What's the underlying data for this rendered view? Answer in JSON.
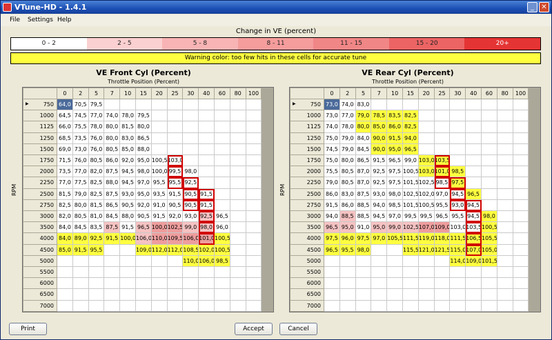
{
  "window": {
    "title": "VTune-HD - 1.4.1"
  },
  "menu": [
    "File",
    "Settings",
    "Help"
  ],
  "change_ve": {
    "title": "Change in VE (percent)",
    "ranges": [
      {
        "label": "0 - 2",
        "color": "#ffffff"
      },
      {
        "label": "2 - 5",
        "color": "#fbd0d0"
      },
      {
        "label": "5 - 8",
        "color": "#f8b4b4"
      },
      {
        "label": "8 - 11",
        "color": "#f59c9c"
      },
      {
        "label": "11 - 15",
        "color": "#f18686"
      },
      {
        "label": "15 - 20",
        "color": "#ec6464"
      },
      {
        "label": "20+",
        "color": "#e53434"
      }
    ]
  },
  "warning": {
    "text": "Warning color: too few hits in these cells for accurate tune",
    "color": "#ffff40"
  },
  "colors": {
    "cell_warn": "#ffff40",
    "cell_light_red": "#f6c2c2",
    "cell_red": "#ee9d9d",
    "highlight": "#d00000"
  },
  "axes": {
    "throttle": [
      "0",
      "2",
      "5",
      "7",
      "10",
      "15",
      "20",
      "25",
      "30",
      "40",
      "60",
      "80",
      "100"
    ],
    "rpm": [
      "750",
      "1000",
      "1125",
      "1250",
      "1500",
      "1750",
      "2000",
      "2250",
      "2500",
      "2750",
      "3000",
      "3500",
      "4000",
      "4500",
      "5000",
      "5500",
      "6000",
      "6500",
      "7000"
    ]
  },
  "tables": [
    {
      "title": "VE Front Cyl (Percent)",
      "xlabel": "Throttle Position (Percent)",
      "ylabel": "RPM",
      "rows": [
        [
          "64,0",
          "70,5",
          "79,5",
          "",
          "",
          "",
          "",
          "",
          "",
          "",
          "",
          "",
          ""
        ],
        [
          "64,5",
          "74,5",
          "77,0",
          "74,0",
          "78,0",
          "79,5",
          "",
          "",
          "",
          "",
          "",
          "",
          ""
        ],
        [
          "66,0",
          "75,5",
          "78,0",
          "80,0",
          "81,5",
          "80,0",
          "",
          "",
          "",
          "",
          "",
          "",
          ""
        ],
        [
          "68,5",
          "73,5",
          "76,0",
          "80,0",
          "83,0",
          "86,5",
          "",
          "",
          "",
          "",
          "",
          "",
          ""
        ],
        [
          "69,0",
          "73,0",
          "76,0",
          "80,5",
          "85,0",
          "88,0",
          "",
          "",
          "",
          "",
          "",
          "",
          ""
        ],
        [
          "71,5",
          "76,0",
          "80,5",
          "86,0",
          "92,0",
          "95,0",
          "100,5",
          "103,0",
          "",
          "",
          "",
          "",
          ""
        ],
        [
          "73,5",
          "77,0",
          "82,0",
          "87,5",
          "94,5",
          "98,0",
          "100,0",
          "99,5",
          "98,0",
          "",
          "",
          "",
          ""
        ],
        [
          "77,0",
          "77,5",
          "82,5",
          "88,0",
          "94,5",
          "97,0",
          "95,5",
          "95,5",
          "92,5",
          "",
          "",
          "",
          ""
        ],
        [
          "81,5",
          "79,0",
          "82,5",
          "87,5",
          "93,0",
          "95,0",
          "93,5",
          "91,5",
          "90,5",
          "91,5",
          "",
          "",
          ""
        ],
        [
          "82,5",
          "80,0",
          "81,5",
          "86,5",
          "90,5",
          "92,0",
          "91,0",
          "90,5",
          "90,5",
          "91,5",
          "",
          "",
          ""
        ],
        [
          "82,0",
          "80,5",
          "81,0",
          "84,5",
          "88,0",
          "90,5",
          "91,5",
          "92,0",
          "93,0",
          "92,5",
          "96,5",
          "",
          ""
        ],
        [
          "84,0",
          "84,5",
          "83,5",
          "87,5",
          "91,5",
          "96,5",
          "100,0",
          "102,5",
          "99,0",
          "98,0",
          "96,0",
          "",
          ""
        ],
        [
          "84,0",
          "89,0",
          "92,5",
          "91,5",
          "100,0",
          "106,0",
          "110,0",
          "109,5",
          "106,0",
          "101,0",
          "100,5",
          "",
          ""
        ],
        [
          "85,0",
          "91,5",
          "95,5",
          "",
          "",
          "109,0",
          "112,0",
          "112,0",
          "108,5",
          "102,0",
          "100,5",
          "",
          ""
        ],
        [
          "",
          "",
          "",
          "",
          "",
          "",
          "",
          "",
          "110,0",
          "106,0",
          "98,5",
          "",
          ""
        ],
        [
          "",
          "",
          "",
          "",
          "",
          "",
          "",
          "",
          "",
          "",
          "",
          "",
          ""
        ],
        [
          "",
          "",
          "",
          "",
          "",
          "",
          "",
          "",
          "",
          "",
          "",
          "",
          ""
        ],
        [
          "",
          "",
          "",
          "",
          "",
          "",
          "",
          "",
          "",
          "",
          "",
          "",
          ""
        ],
        [
          "",
          "",
          "",
          "",
          "",
          "",
          "",
          "",
          "",
          "",
          "",
          "",
          ""
        ]
      ],
      "colors": [
        "SWWW.........",
        "WWWWWW.......",
        "WWWWWW.......",
        "WWWWWW.......",
        "WWWWWW.......",
        "WWWWWWWW.....",
        "WWWWWWWWW....",
        "WWWWWWWWW....",
        "WWWWWWWWWW...",
        "WWWWWWWWWW...",
        "WWWWWWWWWLW..",
        "WWWLWLRRLLW..",
        "YYYYYLRRRRY..",
        "YYY..YYYYYY..",
        "........YYY..",
        ".............",
        ".............",
        ".............",
        "............."
      ],
      "highlighted": [
        [
          5,
          7
        ],
        [
          6,
          7
        ],
        [
          7,
          7
        ],
        [
          7,
          8
        ],
        [
          8,
          8
        ],
        [
          9,
          8
        ],
        [
          8,
          9
        ],
        [
          9,
          9
        ],
        [
          10,
          9
        ],
        [
          11,
          9
        ],
        [
          12,
          9
        ]
      ]
    },
    {
      "title": "VE Rear Cyl (Percent)",
      "xlabel": "Throttle Position (Percent)",
      "ylabel": "RPM",
      "rows": [
        [
          "73,0",
          "74,0",
          "83,0",
          "",
          "",
          "",
          "",
          "",
          "",
          "",
          "",
          "",
          ""
        ],
        [
          "73,0",
          "77,0",
          "79,0",
          "78,5",
          "83,5",
          "82,5",
          "",
          "",
          "",
          "",
          "",
          "",
          ""
        ],
        [
          "74,0",
          "78,0",
          "80,0",
          "85,0",
          "86,0",
          "82,5",
          "",
          "",
          "",
          "",
          "",
          "",
          ""
        ],
        [
          "75,0",
          "79,0",
          "84,0",
          "90,0",
          "91,5",
          "94,0",
          "",
          "",
          "",
          "",
          "",
          "",
          ""
        ],
        [
          "74,5",
          "79,0",
          "84,5",
          "90,0",
          "95,0",
          "96,5",
          "",
          "",
          "",
          "",
          "",
          "",
          ""
        ],
        [
          "75,0",
          "80,0",
          "86,5",
          "91,5",
          "96,5",
          "99,0",
          "103,0",
          "103,5",
          "",
          "",
          "",
          "",
          ""
        ],
        [
          "75,5",
          "80,5",
          "87,0",
          "92,5",
          "97,5",
          "100,5",
          "103,0",
          "101,0",
          "98,5",
          "",
          "",
          "",
          ""
        ],
        [
          "79,0",
          "80,5",
          "87,0",
          "92,5",
          "97,5",
          "101,5",
          "102,5",
          "98,5",
          "97,5",
          "",
          "",
          "",
          ""
        ],
        [
          "86,0",
          "83,0",
          "87,5",
          "93,0",
          "98,0",
          "102,5",
          "102,0",
          "97,0",
          "94,5",
          "96,5",
          "",
          "",
          ""
        ],
        [
          "91,5",
          "86,0",
          "88,5",
          "94,0",
          "98,5",
          "101,5",
          "100,5",
          "95,5",
          "93,0",
          "94,5",
          "",
          "",
          ""
        ],
        [
          "94,0",
          "88,5",
          "88,5",
          "94,5",
          "97,0",
          "99,5",
          "99,5",
          "96,5",
          "95,5",
          "94,5",
          "98,0",
          "",
          ""
        ],
        [
          "96,5",
          "95,0",
          "91,0",
          "95,0",
          "99,0",
          "102,5",
          "107,0",
          "109,0",
          "103,0",
          "103,5",
          "100,5",
          "",
          ""
        ],
        [
          "97,5",
          "96,0",
          "97,5",
          "97,0",
          "105,5",
          "111,5",
          "119,0",
          "118,0",
          "111,5",
          "106,5",
          "105,5",
          "",
          ""
        ],
        [
          "96,5",
          "95,5",
          "98,0",
          "",
          "",
          "115,5",
          "121,0",
          "121,5",
          "115,0",
          "107,0",
          "105,0",
          "",
          ""
        ],
        [
          "",
          "",
          "",
          "",
          "",
          "",
          "",
          "",
          "114,0",
          "109,0",
          "101,5",
          "",
          ""
        ],
        [
          "",
          "",
          "",
          "",
          "",
          "",
          "",
          "",
          "",
          "",
          "",
          "",
          ""
        ],
        [
          "",
          "",
          "",
          "",
          "",
          "",
          "",
          "",
          "",
          "",
          "",
          "",
          ""
        ],
        [
          "",
          "",
          "",
          "",
          "",
          "",
          "",
          "",
          "",
          "",
          "",
          "",
          ""
        ],
        [
          "",
          "",
          "",
          "",
          "",
          "",
          "",
          "",
          "",
          "",
          "",
          "",
          ""
        ]
      ],
      "colors": [
        "SWW..........",
        "WWYYYY.......",
        "WWYYYY.......",
        "WWWYYY.......",
        "WWWYYY.......",
        "WWWWWWYY.....",
        "WWWWWWYYY....",
        "WWWWWWWWY....",
        "WWWWWWWWWY...",
        "WWWWWWWWWW...",
        "WLWWWWWWWWY..",
        "LLWLLLRRWWY..",
        "YYYYYYYYYYY..",
        "YYY..YYYYYY..",
        "........YYY..",
        ".............",
        ".............",
        ".............",
        "............."
      ],
      "highlighted": [
        [
          5,
          7
        ],
        [
          6,
          7
        ],
        [
          7,
          7
        ],
        [
          7,
          8
        ],
        [
          8,
          8
        ],
        [
          9,
          8
        ],
        [
          9,
          9
        ],
        [
          10,
          9
        ],
        [
          11,
          9
        ],
        [
          12,
          9
        ],
        [
          13,
          9
        ]
      ]
    }
  ],
  "buttons": {
    "print": "Print",
    "accept": "Accept",
    "cancel": "Cancel"
  }
}
